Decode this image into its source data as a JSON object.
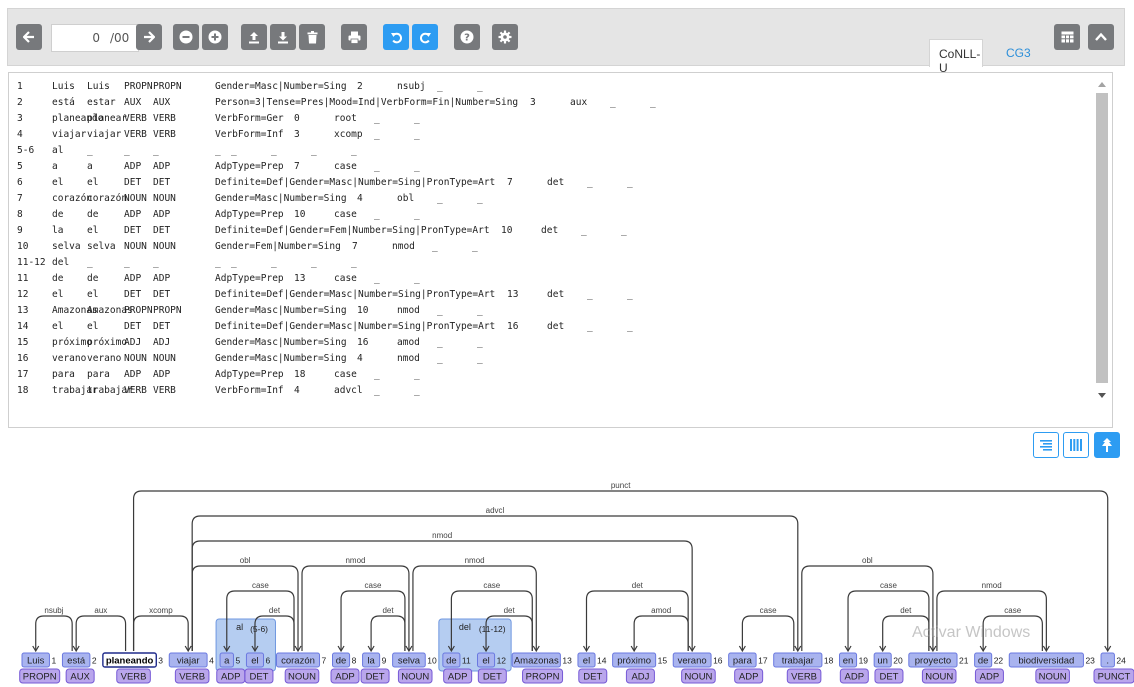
{
  "toolbar": {
    "sentence_value": "0",
    "sentence_total": "/00",
    "tab_conllu": "CoNLL-U",
    "tab_cg3": "CG3"
  },
  "icons": [
    "arrow-left-icon",
    "arrow-right-icon",
    "minus-icon",
    "plus-icon",
    "upload-icon",
    "download-icon",
    "trash-icon",
    "print-icon",
    "undo-icon",
    "redo-icon",
    "help-icon",
    "gear-icon",
    "table-icon",
    "chevron-up-icon",
    "list-view-icon",
    "columns-view-icon",
    "tree-view-icon"
  ],
  "colors": {
    "accent": "#2d9cf2",
    "toolbar_button": "#77797c",
    "word_box": "#a9b4ef",
    "pos_box": "#b9a6ec"
  },
  "conllu": [
    [
      "1",
      "Luis",
      "Luis",
      "PROPN",
      "PROPN",
      "Gender=Masc|Number=Sing",
      "2",
      "nsubj",
      "_",
      "_"
    ],
    [
      "2",
      "está",
      "estar",
      "AUX",
      "AUX",
      "Person=3|Tense=Pres|Mood=Ind|VerbForm=Fin|Number=Sing",
      "3",
      "aux",
      "_",
      "_"
    ],
    [
      "3",
      "planeando",
      "planear",
      "VERB",
      "VERB",
      "VerbForm=Ger",
      "0",
      "root",
      "_",
      "_"
    ],
    [
      "4",
      "viajar",
      "viajar",
      "VERB",
      "VERB",
      "VerbForm=Inf",
      "3",
      "xcomp",
      "_",
      "_"
    ],
    [
      "5-6",
      "al",
      "_",
      "_",
      "_",
      "_",
      "_",
      "_",
      "_",
      "_"
    ],
    [
      "5",
      "a",
      "a",
      "ADP",
      "ADP",
      "AdpType=Prep",
      "7",
      "case",
      "_",
      "_"
    ],
    [
      "6",
      "el",
      "el",
      "DET",
      "DET",
      "Definite=Def|Gender=Masc|Number=Sing|PronType=Art",
      "7",
      "det",
      "_",
      "_"
    ],
    [
      "7",
      "corazón",
      "corazón",
      "NOUN",
      "NOUN",
      "Gender=Masc|Number=Sing",
      "4",
      "obl",
      "_",
      "_"
    ],
    [
      "8",
      "de",
      "de",
      "ADP",
      "ADP",
      "AdpType=Prep",
      "10",
      "case",
      "_",
      "_"
    ],
    [
      "9",
      "la",
      "el",
      "DET",
      "DET",
      "Definite=Def|Gender=Fem|Number=Sing|PronType=Art",
      "10",
      "det",
      "_",
      "_"
    ],
    [
      "10",
      "selva",
      "selva",
      "NOUN",
      "NOUN",
      "Gender=Fem|Number=Sing",
      "7",
      "nmod",
      "_",
      "_"
    ],
    [
      "11-12",
      "del",
      "_",
      "_",
      "_",
      "_",
      "_",
      "_",
      "_",
      "_"
    ],
    [
      "11",
      "de",
      "de",
      "ADP",
      "ADP",
      "AdpType=Prep",
      "13",
      "case",
      "_",
      "_"
    ],
    [
      "12",
      "el",
      "el",
      "DET",
      "DET",
      "Definite=Def|Gender=Masc|Number=Sing|PronType=Art",
      "13",
      "det",
      "_",
      "_"
    ],
    [
      "13",
      "Amazonas",
      "Amazonas",
      "PROPN",
      "PROPN",
      "Gender=Masc|Number=Sing",
      "10",
      "nmod",
      "_",
      "_"
    ],
    [
      "14",
      "el",
      "el",
      "DET",
      "DET",
      "Definite=Def|Gender=Masc|Number=Sing|PronType=Art",
      "16",
      "det",
      "_",
      "_"
    ],
    [
      "15",
      "próximo",
      "próximo",
      "ADJ",
      "ADJ",
      "Gender=Masc|Number=Sing",
      "16",
      "amod",
      "_",
      "_"
    ],
    [
      "16",
      "verano",
      "verano",
      "NOUN",
      "NOUN",
      "Gender=Masc|Number=Sing",
      "4",
      "nmod",
      "_",
      "_"
    ],
    [
      "17",
      "para",
      "para",
      "ADP",
      "ADP",
      "AdpType=Prep",
      "18",
      "case",
      "_",
      "_"
    ],
    [
      "18",
      "trabajar",
      "trabajar",
      "VERB",
      "VERB",
      "VerbForm=Inf",
      "4",
      "advcl",
      "_",
      "_"
    ]
  ],
  "tree": {
    "words": [
      {
        "form": "Luis",
        "id": "1",
        "pos": "PROPN"
      },
      {
        "form": "está",
        "id": "2",
        "pos": "AUX"
      },
      {
        "form": "planeando",
        "id": "3",
        "pos": "VERB"
      },
      {
        "form": "viajar",
        "id": "4",
        "pos": "VERB"
      },
      {
        "form": "a",
        "id": "5",
        "pos": "ADP"
      },
      {
        "form": "el",
        "id": "6",
        "pos": "DET"
      },
      {
        "form": "corazón",
        "id": "7",
        "pos": "NOUN"
      },
      {
        "form": "de",
        "id": "8",
        "pos": "ADP"
      },
      {
        "form": "la",
        "id": "9",
        "pos": "DET"
      },
      {
        "form": "selva",
        "id": "10",
        "pos": "NOUN"
      },
      {
        "form": "de",
        "id": "11",
        "pos": "ADP"
      },
      {
        "form": "el",
        "id": "12",
        "pos": "DET"
      },
      {
        "form": "Amazonas",
        "id": "13",
        "pos": "PROPN"
      },
      {
        "form": "el",
        "id": "14",
        "pos": "DET"
      },
      {
        "form": "próximo",
        "id": "15",
        "pos": "ADJ"
      },
      {
        "form": "verano",
        "id": "16",
        "pos": "NOUN"
      },
      {
        "form": "para",
        "id": "17",
        "pos": "ADP"
      },
      {
        "form": "trabajar",
        "id": "18",
        "pos": "VERB"
      },
      {
        "form": "en",
        "id": "19",
        "pos": "ADP"
      },
      {
        "form": "un",
        "id": "20",
        "pos": "DET"
      },
      {
        "form": "proyecto",
        "id": "21",
        "pos": "NOUN"
      },
      {
        "form": "de",
        "id": "22",
        "pos": "ADP"
      },
      {
        "form": "biodiversidad",
        "id": "23",
        "pos": "NOUN"
      },
      {
        "form": ".",
        "id": "24",
        "pos": "PUNCT"
      }
    ],
    "root_id": "3",
    "multiword": [
      {
        "form": "al",
        "range": "(5-6)",
        "first": "5",
        "last": "6"
      },
      {
        "form": "del",
        "range": "(11-12)",
        "first": "11",
        "last": "12"
      }
    ],
    "arcs": [
      {
        "head": "2",
        "dep": "1",
        "label": "nsubj"
      },
      {
        "head": "3",
        "dep": "2",
        "label": "aux"
      },
      {
        "head": "3",
        "dep": "4",
        "label": "xcomp"
      },
      {
        "head": "7",
        "dep": "5",
        "label": "case"
      },
      {
        "head": "7",
        "dep": "6",
        "label": "det"
      },
      {
        "head": "4",
        "dep": "7",
        "label": "obl"
      },
      {
        "head": "10",
        "dep": "8",
        "label": "case"
      },
      {
        "head": "10",
        "dep": "9",
        "label": "det"
      },
      {
        "head": "7",
        "dep": "10",
        "label": "nmod"
      },
      {
        "head": "13",
        "dep": "11",
        "label": "case"
      },
      {
        "head": "13",
        "dep": "12",
        "label": "det"
      },
      {
        "head": "10",
        "dep": "13",
        "label": "nmod"
      },
      {
        "head": "16",
        "dep": "14",
        "label": "det"
      },
      {
        "head": "16",
        "dep": "15",
        "label": "amod"
      },
      {
        "head": "4",
        "dep": "16",
        "label": "nmod"
      },
      {
        "head": "18",
        "dep": "17",
        "label": "case"
      },
      {
        "head": "4",
        "dep": "18",
        "label": "advcl"
      },
      {
        "head": "21",
        "dep": "19",
        "label": "case"
      },
      {
        "head": "21",
        "dep": "20",
        "label": "det"
      },
      {
        "head": "18",
        "dep": "21",
        "label": "obl"
      },
      {
        "head": "23",
        "dep": "22",
        "label": "case"
      },
      {
        "head": "21",
        "dep": "23",
        "label": "nmod"
      },
      {
        "head": "3",
        "dep": "24",
        "label": "punct"
      }
    ]
  },
  "watermark": "Activar Windows"
}
